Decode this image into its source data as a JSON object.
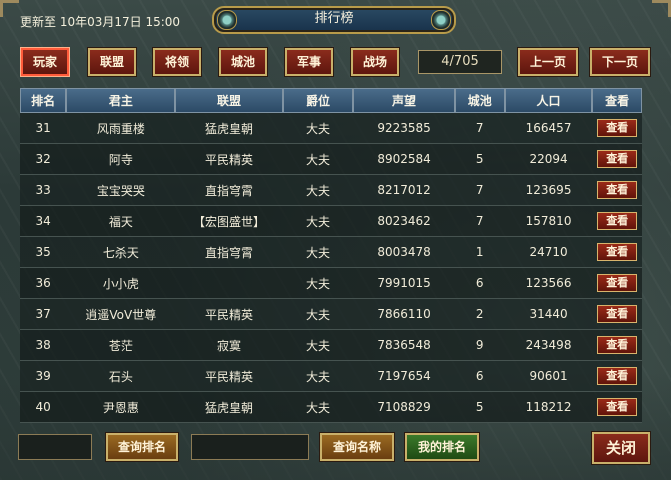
{
  "header": {
    "updated_text": "更新至 10年03月17日 15:00",
    "title": "排行榜"
  },
  "tabs": [
    {
      "label": "玩家",
      "active": true
    },
    {
      "label": "联盟",
      "active": false
    },
    {
      "label": "将领",
      "active": false
    },
    {
      "label": "城池",
      "active": false
    },
    {
      "label": "军事",
      "active": false
    },
    {
      "label": "战场",
      "active": false
    }
  ],
  "pagination": {
    "page_text": "4/705",
    "prev_label": "上一页",
    "next_label": "下一页"
  },
  "table": {
    "columns": [
      "排名",
      "君主",
      "联盟",
      "爵位",
      "声望",
      "城池",
      "人口",
      "查看"
    ],
    "view_label": "查看",
    "rows": [
      [
        "31",
        "风雨重楼",
        "猛虎皇朝",
        "大夫",
        "9223585",
        "7",
        "166457"
      ],
      [
        "32",
        "阿寺",
        "平民精英",
        "大夫",
        "8902584",
        "5",
        "22094"
      ],
      [
        "33",
        "宝宝哭哭",
        "直指穹霄",
        "大夫",
        "8217012",
        "7",
        "123695"
      ],
      [
        "34",
        "福天",
        "【宏图盛世】",
        "大夫",
        "8023462",
        "7",
        "157810"
      ],
      [
        "35",
        "七杀天",
        "直指穹霄",
        "大夫",
        "8003478",
        "1",
        "24710"
      ],
      [
        "36",
        "小小虎",
        "",
        "大夫",
        "7991015",
        "6",
        "123566"
      ],
      [
        "37",
        "逍遥VoV世尊",
        "平民精英",
        "大夫",
        "7866110",
        "2",
        "31440"
      ],
      [
        "38",
        "苍茫",
        "寂寞",
        "大夫",
        "7836548",
        "9",
        "243498"
      ],
      [
        "39",
        "石头",
        "平民精英",
        "大夫",
        "7197654",
        "6",
        "90601"
      ],
      [
        "40",
        "尹恩惠",
        "猛虎皇朝",
        "大夫",
        "7108829",
        "5",
        "118212"
      ]
    ]
  },
  "footer": {
    "rank_search_value": "",
    "query_rank_label": "查询排名",
    "name_search_value": "",
    "query_name_label": "查询名称",
    "my_rank_label": "我的排名",
    "close_label": "关闭"
  }
}
